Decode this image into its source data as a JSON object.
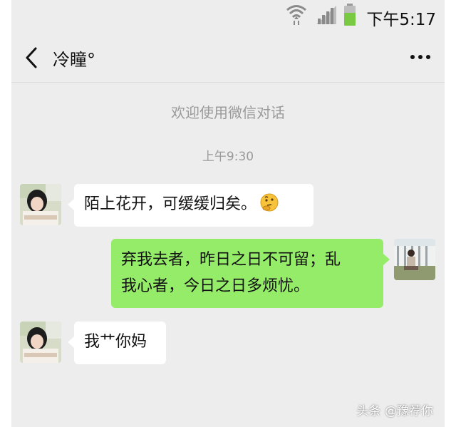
{
  "status_bar": {
    "time": "下午5:17",
    "wifi_icon": "wifi-icon",
    "signal_icon": "signal-icon",
    "battery_icon": "battery-icon",
    "battery_color": "#7ac943"
  },
  "header": {
    "back_icon": "back-arrow-icon",
    "title": "冷瞳°",
    "more_icon": "more-icon"
  },
  "conversation": {
    "welcome": "欢迎使用微信对话",
    "timestamp": "上午9:30",
    "messages": [
      {
        "sender": "contact",
        "text": "陌上花开，可缓缓归矣。",
        "emoji": "thinking-face-emoji"
      },
      {
        "sender": "self",
        "line1": "弃我去者，昨日之日不可留；乱",
        "line2": "我心者，今日之日多烦忧。"
      },
      {
        "sender": "contact",
        "text": "我艹你妈"
      }
    ]
  },
  "watermark": "头条 @豫荐你",
  "colors": {
    "background": "#ededed",
    "self_bubble": "#95ec69",
    "contact_bubble": "#ffffff",
    "system_text": "#9a9a9a"
  }
}
